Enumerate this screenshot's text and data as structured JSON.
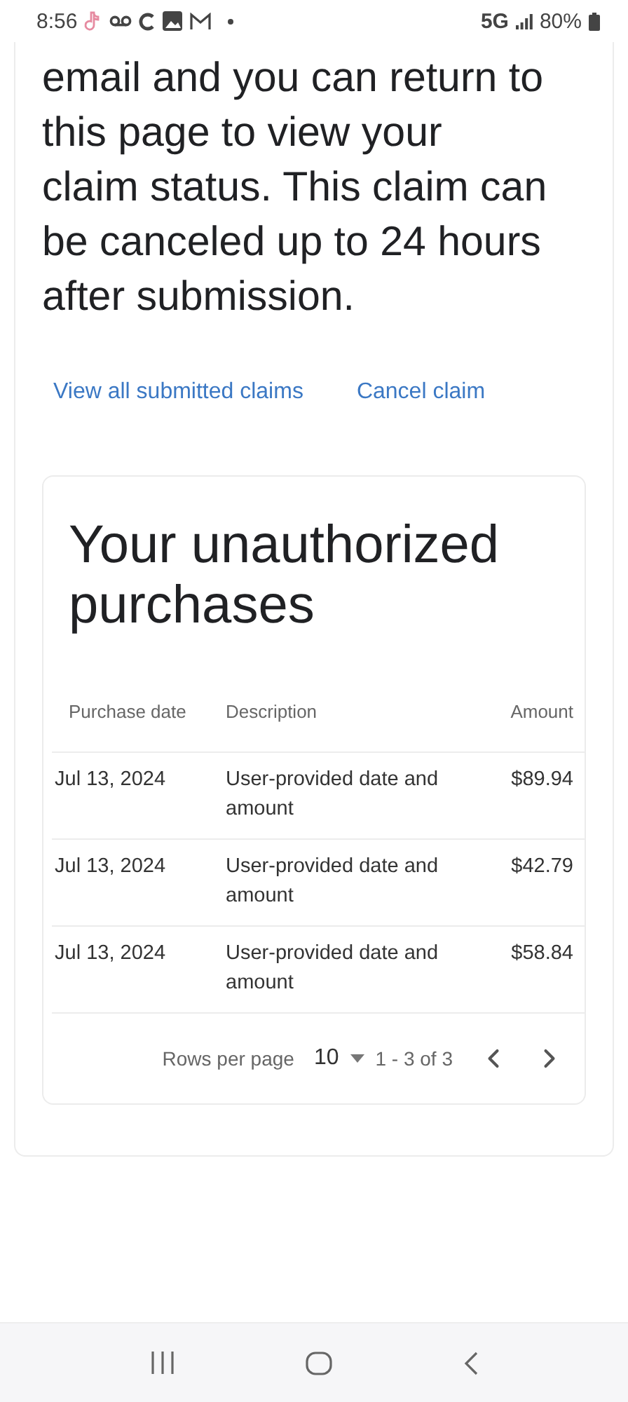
{
  "status_bar": {
    "time": "8:56",
    "network": "5G",
    "battery": "80%"
  },
  "message": "email and you can return to this page to view your claim status. This claim can be canceled up to 24 hours after submission.",
  "links": [
    "View all submitted claims",
    "Cancel claim"
  ],
  "purchases": {
    "title": "Your unauthorized purchases",
    "columns": [
      "Purchase date",
      "Description",
      "Amount"
    ],
    "rows": [
      {
        "date": "Jul 13, 2024",
        "description": "User-provided date and amount",
        "amount": "$89.94"
      },
      {
        "date": "Jul 13, 2024",
        "description": "User-provided date and amount",
        "amount": "$42.79"
      },
      {
        "date": "Jul 13, 2024",
        "description": "User-provided date and amount",
        "amount": "$58.84"
      }
    ],
    "pagination": {
      "rows_per_page_label": "Rows per page",
      "rows_per_page": "10",
      "range": "1 - 3 of 3"
    }
  }
}
